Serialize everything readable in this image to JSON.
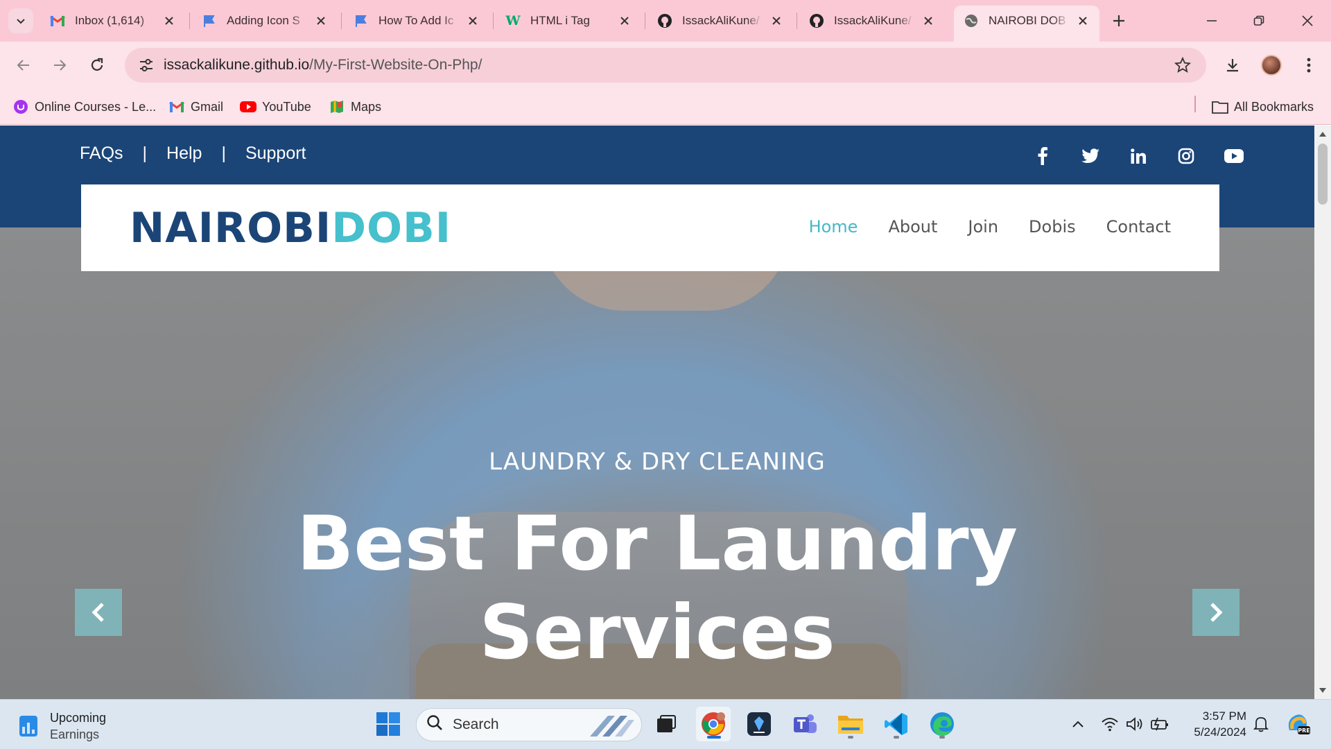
{
  "browser": {
    "tabs": [
      {
        "title": "Inbox (1,614)",
        "favicon": "gmail-icon"
      },
      {
        "title": "Adding Icon S",
        "favicon": "flag-icon"
      },
      {
        "title": "How To Add Ic",
        "favicon": "flag-icon"
      },
      {
        "title": "HTML i Tag",
        "favicon": "w3schools-icon"
      },
      {
        "title": "IssackAliKune/",
        "favicon": "github-icon"
      },
      {
        "title": "IssackAliKune/",
        "favicon": "github-icon"
      },
      {
        "title": "NAIROBI DOB",
        "favicon": "globe-icon",
        "active": true
      }
    ],
    "url_host": "issackalikune.github.io",
    "url_path": "/My-First-Website-On-Php/",
    "bookmarks": [
      {
        "label": "Online Courses - Le...",
        "icon": "udemy-icon"
      },
      {
        "label": "Gmail",
        "icon": "gmail-icon"
      },
      {
        "label": "YouTube",
        "icon": "youtube-icon"
      },
      {
        "label": "Maps",
        "icon": "maps-icon"
      }
    ],
    "all_bookmarks": "All Bookmarks"
  },
  "site": {
    "toplinks": [
      "FAQs",
      "Help",
      "Support"
    ],
    "separator": "|",
    "socials": [
      "facebook-icon",
      "twitter-icon",
      "linkedin-icon",
      "instagram-icon",
      "youtube-icon"
    ],
    "logo_part1": "NAIROBI",
    "logo_part2": "DOBI",
    "nav": [
      "Home",
      "About",
      "Join",
      "Dobis",
      "Contact"
    ],
    "active_nav": "Home",
    "hero_subtitle": "LAUNDRY & DRY CLEANING",
    "hero_title_line1": "Best For Laundry",
    "hero_title_line2": "Services",
    "colors": {
      "primary": "#1b4577",
      "accent": "#45c0cc"
    }
  },
  "taskbar": {
    "widget_title": "Upcoming",
    "widget_subtitle": "Earnings",
    "search_placeholder": "Search",
    "time": "3:57 PM",
    "date": "5/24/2024"
  }
}
